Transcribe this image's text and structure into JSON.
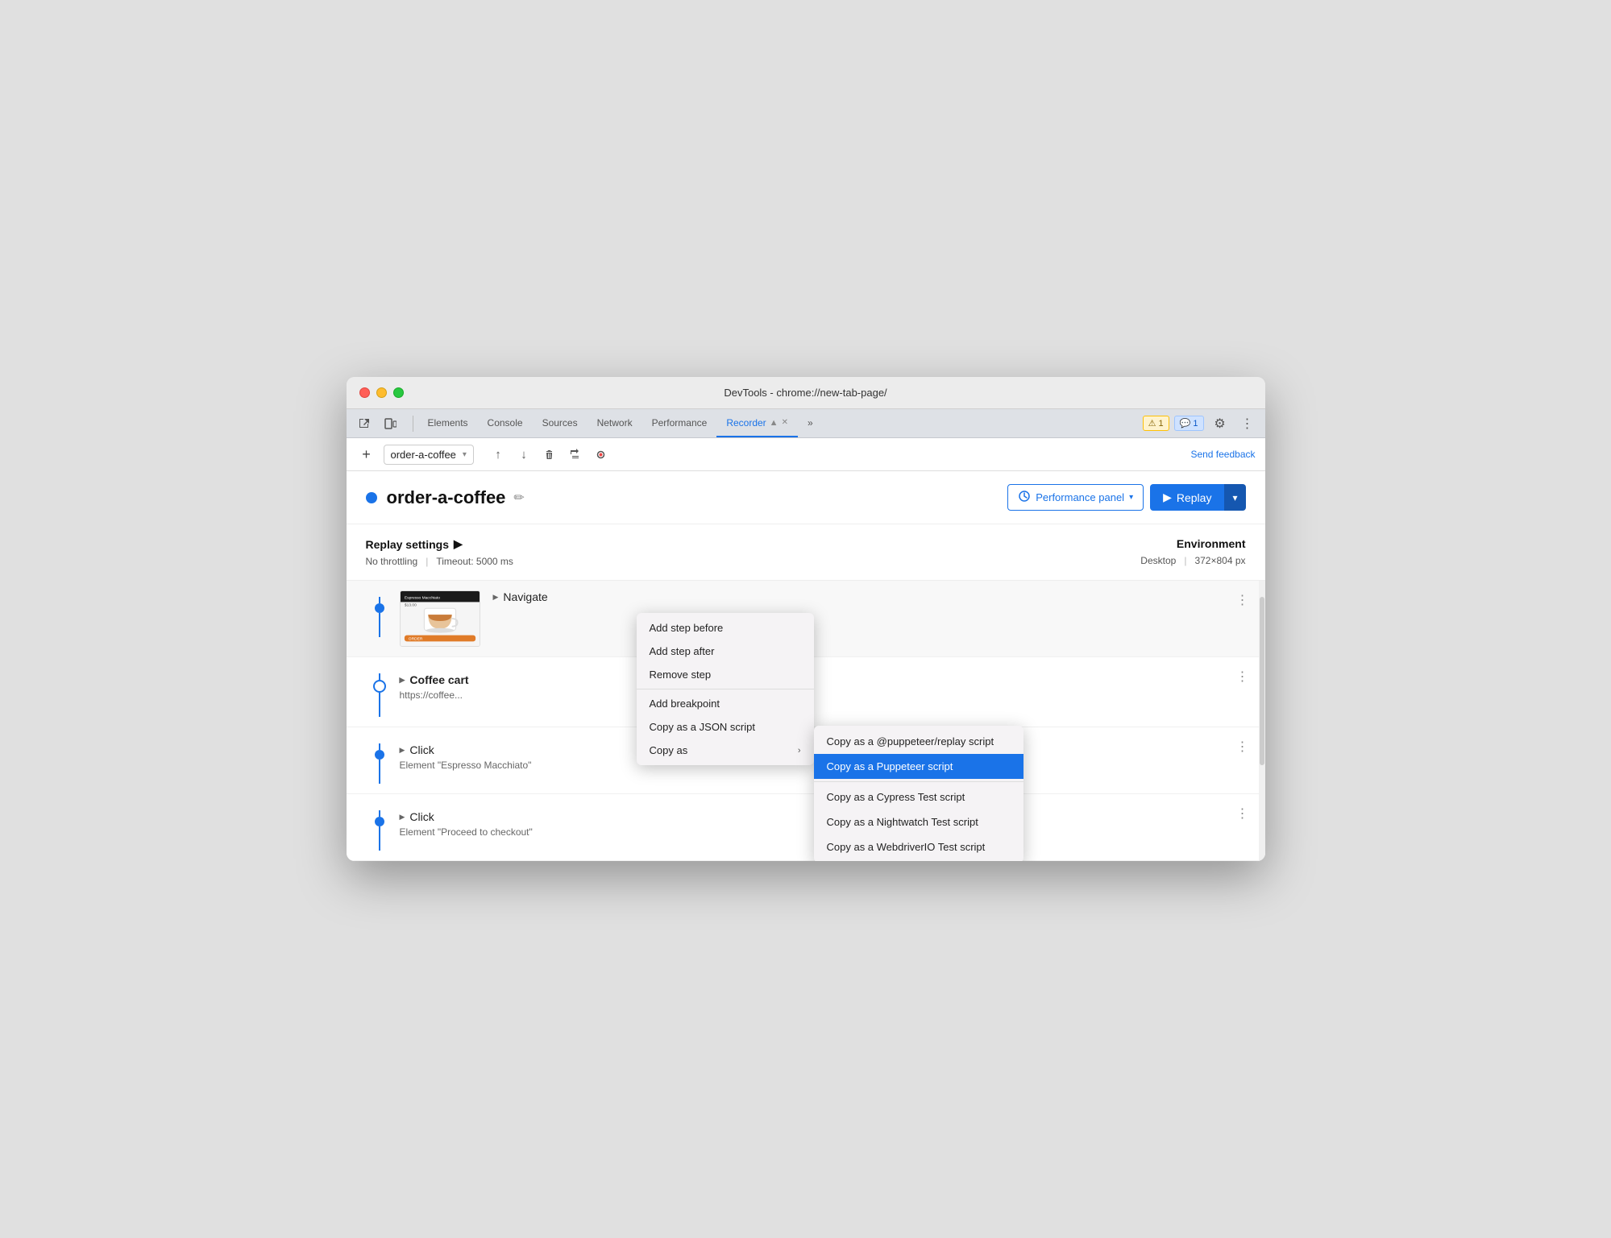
{
  "window": {
    "title": "DevTools - chrome://new-tab-page/"
  },
  "titlebar": {
    "title": "DevTools - chrome://new-tab-page/"
  },
  "devtools": {
    "tabs": [
      {
        "label": "Elements",
        "active": false
      },
      {
        "label": "Console",
        "active": false
      },
      {
        "label": "Sources",
        "active": false
      },
      {
        "label": "Network",
        "active": false
      },
      {
        "label": "Performance",
        "active": false
      },
      {
        "label": "Recorder",
        "active": true
      },
      {
        "label": "»",
        "active": false
      }
    ],
    "badges": {
      "warning": "⚠ 1",
      "info": "💬 1"
    }
  },
  "recorder_toolbar": {
    "add_btn": "+",
    "recording_name": "order-a-coffee",
    "send_feedback": "Send feedback",
    "icons": {
      "export_up": "↑",
      "export_down": "↓",
      "delete": "🗑",
      "step_over": "⇒",
      "record": "◉"
    }
  },
  "recording": {
    "dot_color": "#1a73e8",
    "title": "order-a-coffee",
    "edit_icon": "✏",
    "perf_panel_btn": "Performance panel",
    "replay_btn": "Replay"
  },
  "settings": {
    "title": "Replay settings",
    "arrow": "▶",
    "throttling": "No throttling",
    "timeout": "Timeout: 5000 ms",
    "environment_title": "Environment",
    "environment_type": "Desktop",
    "environment_size": "372×804 px"
  },
  "steps": [
    {
      "type": "navigate",
      "label": "Navigate",
      "has_thumbnail": true,
      "thumbnail_alt": "Coffee app screenshot",
      "dot_type": "filled"
    },
    {
      "type": "coffee_cart",
      "label": "Coffee cart",
      "subtitle": "https://coffee...",
      "dot_type": "outline",
      "bold": true
    },
    {
      "type": "click",
      "label": "Click",
      "subtitle": "Element \"Espresso Macchiato\"",
      "dot_type": "filled"
    },
    {
      "type": "click2",
      "label": "Click",
      "subtitle": "Element \"Proceed to checkout\"",
      "dot_type": "filled"
    }
  ],
  "context_menu": {
    "items": [
      {
        "label": "Add step before",
        "has_submenu": false
      },
      {
        "label": "Add step after",
        "has_submenu": false
      },
      {
        "label": "Remove step",
        "has_submenu": false
      },
      {
        "separator": true
      },
      {
        "label": "Add breakpoint",
        "has_submenu": false
      },
      {
        "label": "Copy as a JSON script",
        "has_submenu": false
      },
      {
        "label": "Copy as",
        "has_submenu": true
      }
    ]
  },
  "submenu": {
    "items": [
      {
        "label": "Copy as a @puppeteer/replay script",
        "active": false
      },
      {
        "label": "Copy as a Puppeteer script",
        "active": true
      },
      {
        "separator": true
      },
      {
        "label": "Copy as a Cypress Test script",
        "active": false
      },
      {
        "label": "Copy as a Nightwatch Test script",
        "active": false
      },
      {
        "label": "Copy as a WebdriverIO Test script",
        "active": false
      }
    ]
  }
}
